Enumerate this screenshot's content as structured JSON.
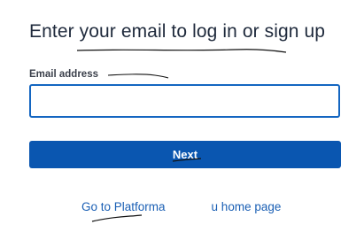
{
  "login": {
    "heading": "Enter your email to log in or sign up",
    "email_label": "Email address",
    "email_value": "",
    "email_placeholder": "",
    "next_label": "Next",
    "home_link_start": "Go to Platforma",
    "home_link_end": "u home page"
  },
  "colors": {
    "accent": "#0a56b0",
    "input_border": "#1466c1",
    "link": "#1a5fb4",
    "heading_text": "#1f2a3c"
  }
}
